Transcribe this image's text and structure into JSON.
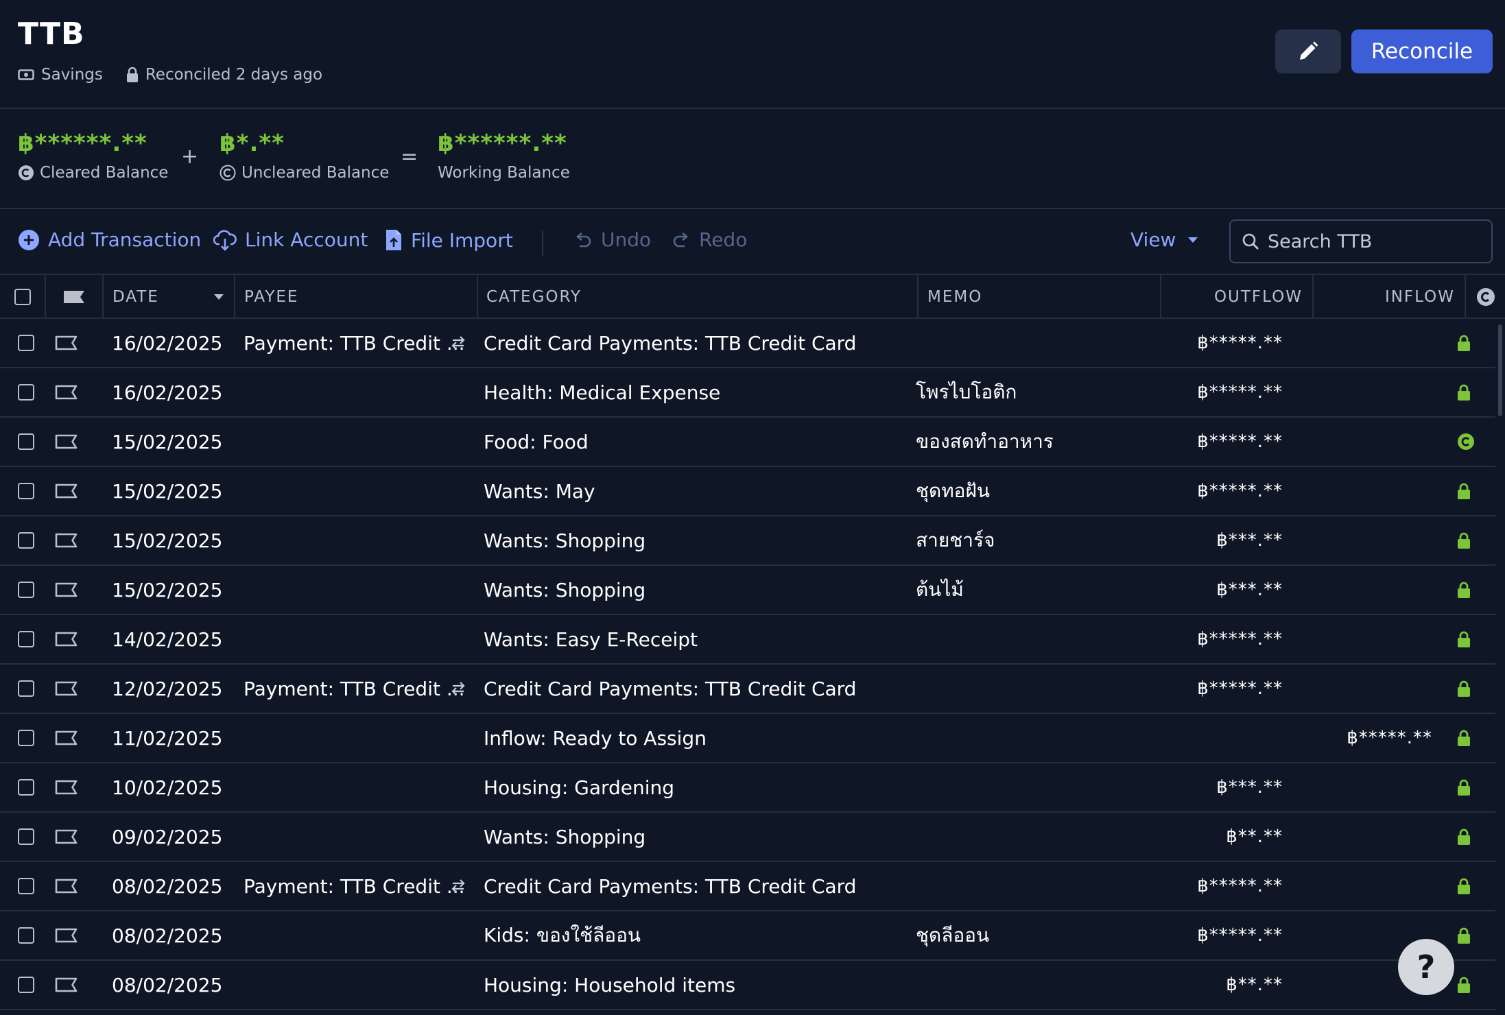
{
  "account": {
    "name": "TTB",
    "type_label": "Savings",
    "reconciled_label": "Reconciled 2 days ago",
    "reconcile_button": "Reconcile"
  },
  "balances": {
    "cleared": {
      "amount": "฿******.**",
      "label": "Cleared Balance"
    },
    "plus": "+",
    "uncleared": {
      "amount": "฿*.**",
      "label": "Uncleared Balance"
    },
    "equals": "=",
    "working": {
      "amount": "฿******.**",
      "label": "Working Balance"
    }
  },
  "toolbar": {
    "add_transaction": "Add Transaction",
    "link_account": "Link Account",
    "file_import": "File Import",
    "undo": "Undo",
    "redo": "Redo",
    "view": "View",
    "search_placeholder": "Search TTB"
  },
  "columns": {
    "date": "DATE",
    "payee": "PAYEE",
    "category": "CATEGORY",
    "memo": "MEMO",
    "outflow": "OUTFLOW",
    "inflow": "INFLOW"
  },
  "transactions": [
    {
      "date": "16/02/2025",
      "payee": "Payment: TTB Credit ...",
      "transfer": true,
      "category": "Credit Card Payments: TTB Credit Card",
      "memo": "",
      "outflow": "฿*****.**",
      "inflow": "",
      "status": "reconciled"
    },
    {
      "date": "16/02/2025",
      "payee": "",
      "transfer": false,
      "category": "Health: Medical Expense",
      "memo": "โพรไบโอติก",
      "outflow": "฿*****.**",
      "inflow": "",
      "status": "reconciled"
    },
    {
      "date": "15/02/2025",
      "payee": "",
      "transfer": false,
      "category": "Food: Food",
      "memo": "ของสดทำอาหาร",
      "outflow": "฿*****.**",
      "inflow": "",
      "status": "cleared"
    },
    {
      "date": "15/02/2025",
      "payee": "",
      "transfer": false,
      "category": "Wants: May",
      "memo": "ชุดทอฝัน",
      "outflow": "฿*****.**",
      "inflow": "",
      "status": "reconciled"
    },
    {
      "date": "15/02/2025",
      "payee": "",
      "transfer": false,
      "category": "Wants: Shopping",
      "memo": "สายชาร์จ",
      "outflow": "฿***.**",
      "inflow": "",
      "status": "reconciled"
    },
    {
      "date": "15/02/2025",
      "payee": "",
      "transfer": false,
      "category": "Wants: Shopping",
      "memo": "ต้นไม้",
      "outflow": "฿***.**",
      "inflow": "",
      "status": "reconciled"
    },
    {
      "date": "14/02/2025",
      "payee": "",
      "transfer": false,
      "category": "Wants: Easy E-Receipt",
      "memo": "",
      "outflow": "฿*****.**",
      "inflow": "",
      "status": "reconciled"
    },
    {
      "date": "12/02/2025",
      "payee": "Payment: TTB Credit ...",
      "transfer": true,
      "category": "Credit Card Payments: TTB Credit Card",
      "memo": "",
      "outflow": "฿*****.**",
      "inflow": "",
      "status": "reconciled"
    },
    {
      "date": "11/02/2025",
      "payee": "",
      "transfer": false,
      "category": "Inflow: Ready to Assign",
      "memo": "",
      "outflow": "",
      "inflow": "฿*****.**",
      "status": "reconciled"
    },
    {
      "date": "10/02/2025",
      "payee": "",
      "transfer": false,
      "category": "Housing: Gardening",
      "memo": "",
      "outflow": "฿***.**",
      "inflow": "",
      "status": "reconciled"
    },
    {
      "date": "09/02/2025",
      "payee": "",
      "transfer": false,
      "category": "Wants: Shopping",
      "memo": "",
      "outflow": "฿**.**",
      "inflow": "",
      "status": "reconciled"
    },
    {
      "date": "08/02/2025",
      "payee": "Payment: TTB Credit ...",
      "transfer": true,
      "category": "Credit Card Payments: TTB Credit Card",
      "memo": "",
      "outflow": "฿*****.**",
      "inflow": "",
      "status": "reconciled"
    },
    {
      "date": "08/02/2025",
      "payee": "",
      "transfer": false,
      "category": "Kids: ของใช้ลีออน",
      "memo": "ชุดลีออน",
      "outflow": "฿*****.**",
      "inflow": "",
      "status": "reconciled"
    },
    {
      "date": "08/02/2025",
      "payee": "",
      "transfer": false,
      "category": "Housing: Household items",
      "memo": "",
      "outflow": "฿**.**",
      "inflow": "",
      "status": "reconciled"
    }
  ],
  "help_label": "?",
  "colors": {
    "background": "#0f1626",
    "accent": "#3e5ed8",
    "link": "#8ea6ff",
    "balance_green": "#7cc43a",
    "status_green": "#7cc43a"
  }
}
